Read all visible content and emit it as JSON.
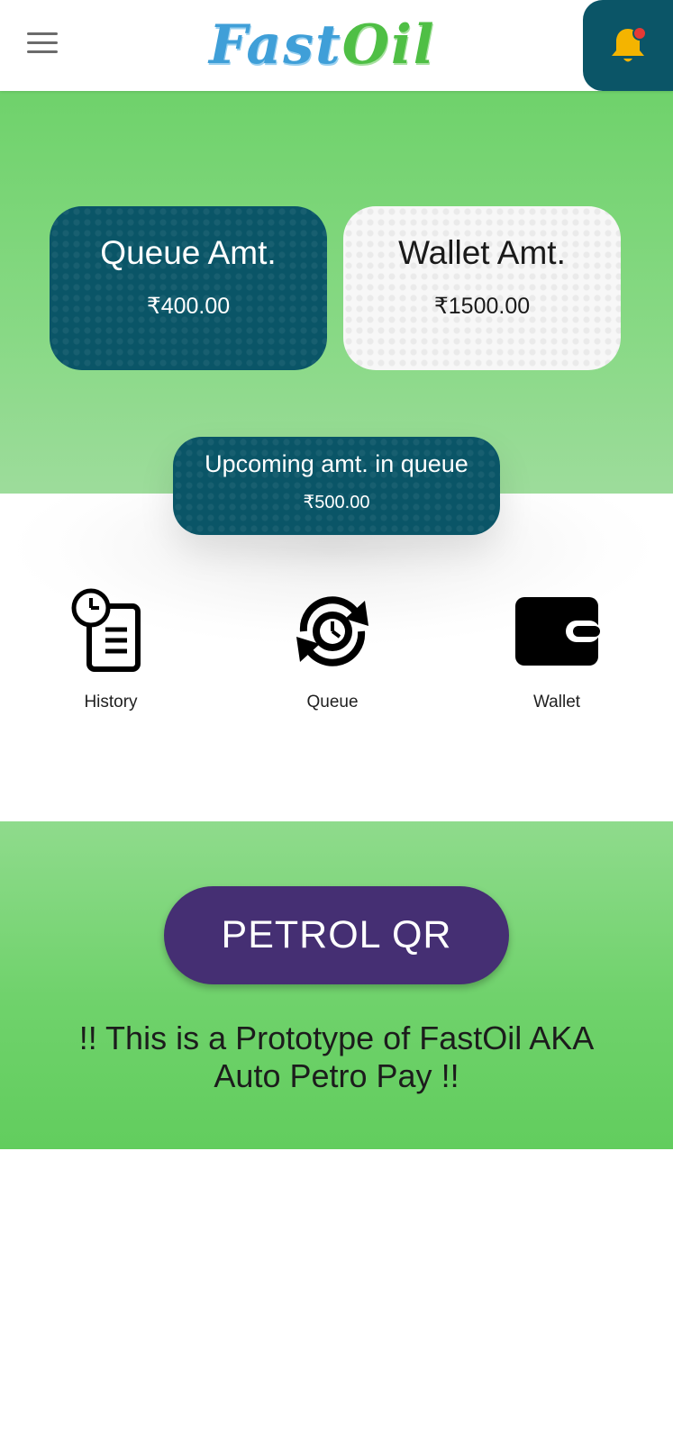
{
  "header": {
    "logo_fast": "Fast",
    "logo_oil": "Oil",
    "menu_icon": "hamburger-menu-icon",
    "bell_icon": "notification-bell-icon",
    "bell_color": "#0b5567",
    "notification_dot_color": "#e53935"
  },
  "cards": {
    "queue": {
      "title": "Queue Amt.",
      "value": "₹400.00"
    },
    "wallet": {
      "title": "Wallet Amt.",
      "value": "₹1500.00"
    }
  },
  "upcoming": {
    "title": "Upcoming amt. in queue",
    "value": "₹500.00"
  },
  "quick_actions": [
    {
      "label": "History",
      "icon": "history-clipboard-icon"
    },
    {
      "label": "Queue",
      "icon": "queue-clock-refresh-icon"
    },
    {
      "label": "Wallet",
      "icon": "wallet-icon"
    }
  ],
  "qr_button": {
    "label": "PETROL QR"
  },
  "prototype_note": "!! This is a Prototype of FastOil AKA Auto Petro Pay !!",
  "colors": {
    "teal": "#0a5567",
    "green": "#6fd26b",
    "purple": "#452f73",
    "logo_blue": "#3f9fd8",
    "logo_green": "#4fbf45"
  }
}
